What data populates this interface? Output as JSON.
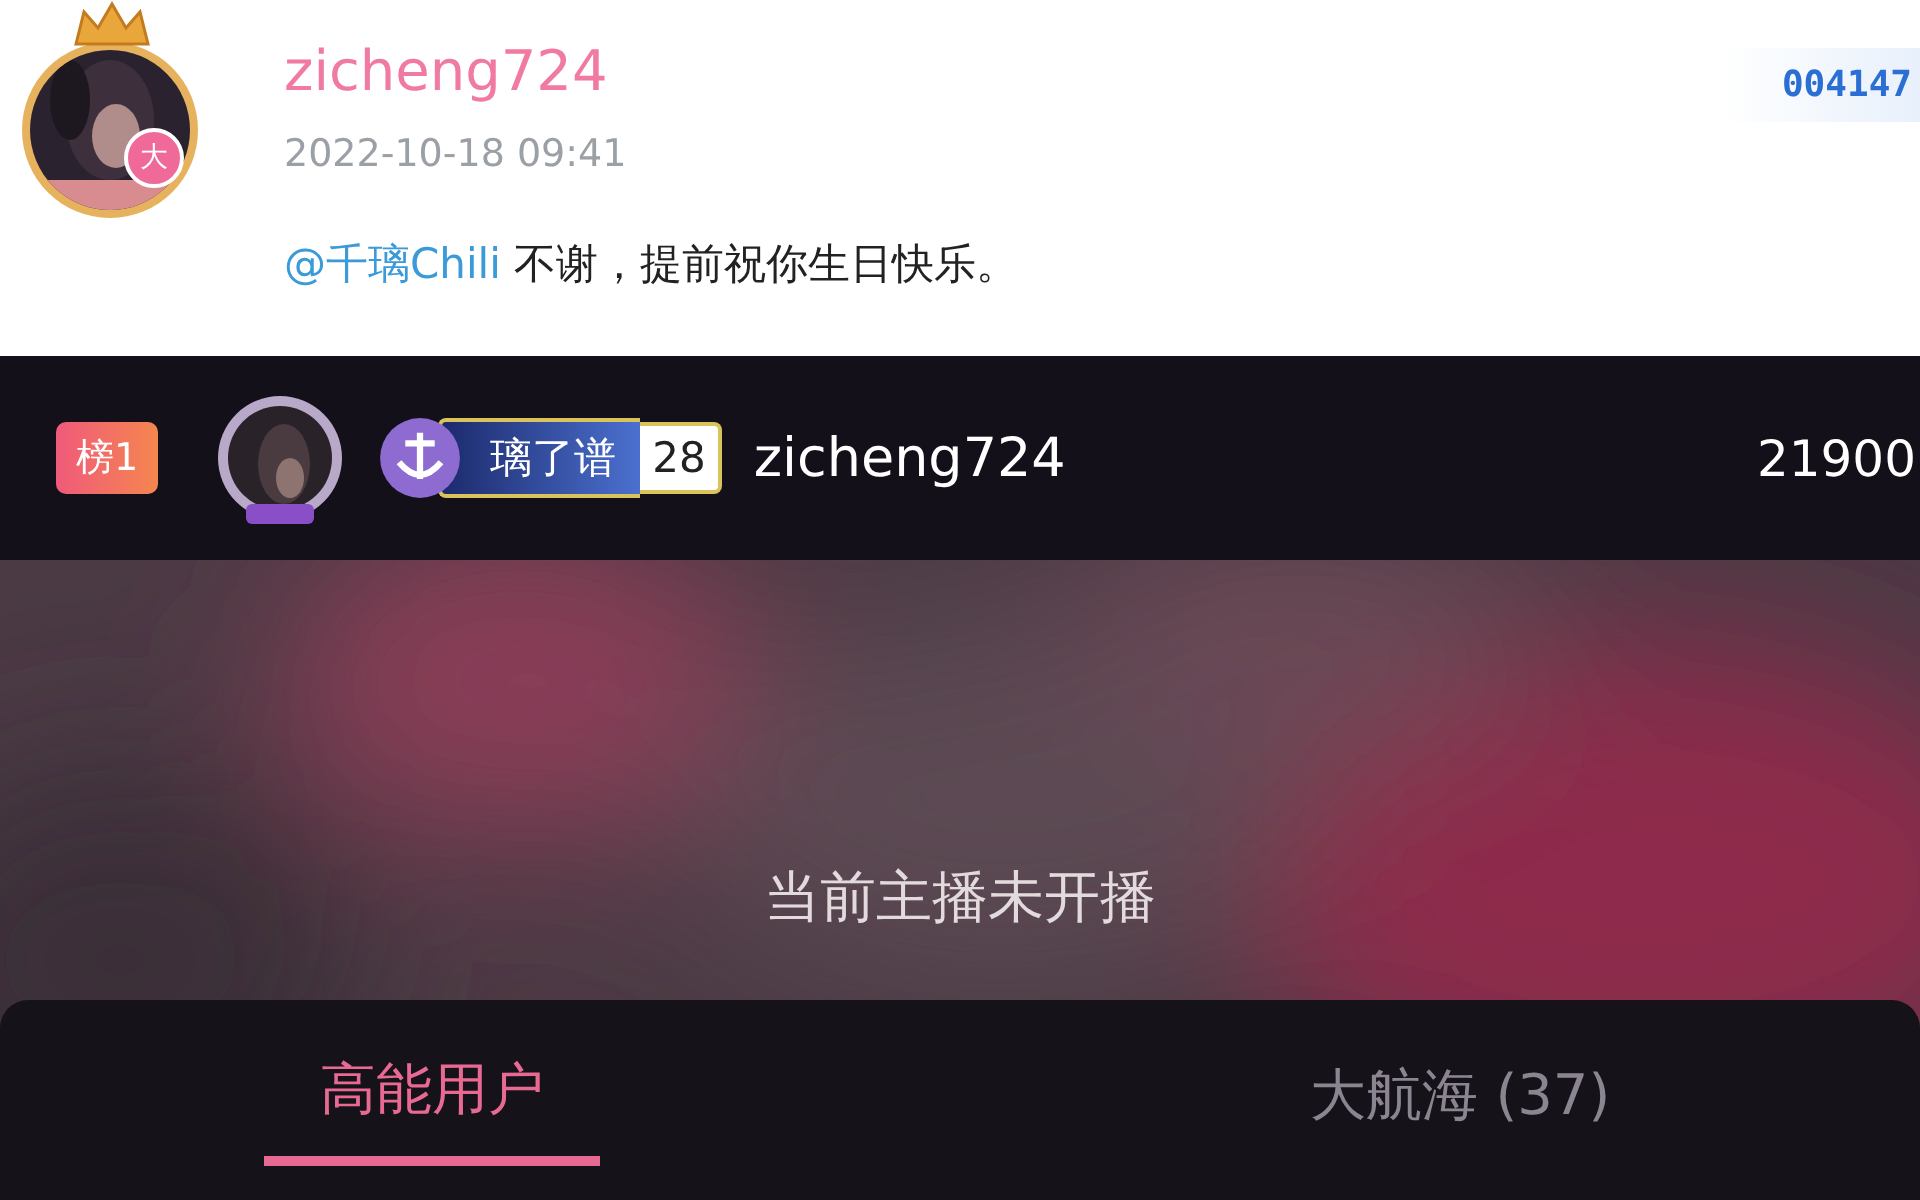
{
  "comment": {
    "username": "zicheng724",
    "avatar_badge": "大",
    "time": "2022-10-18 09:41",
    "mention": "@千璃Chili",
    "text": "不谢，提前祝你生日快乐。",
    "number_badge": "004147"
  },
  "rank_row": {
    "rank": "榜1",
    "medal_name": "璃了谱",
    "medal_level": "28",
    "username": "zicheng724",
    "score": "21900"
  },
  "stream": {
    "status": "当前主播未开播"
  },
  "tabs": [
    {
      "label": "高能用户",
      "selected": true
    },
    {
      "label": "大航海 (37)",
      "selected": false
    }
  ]
}
